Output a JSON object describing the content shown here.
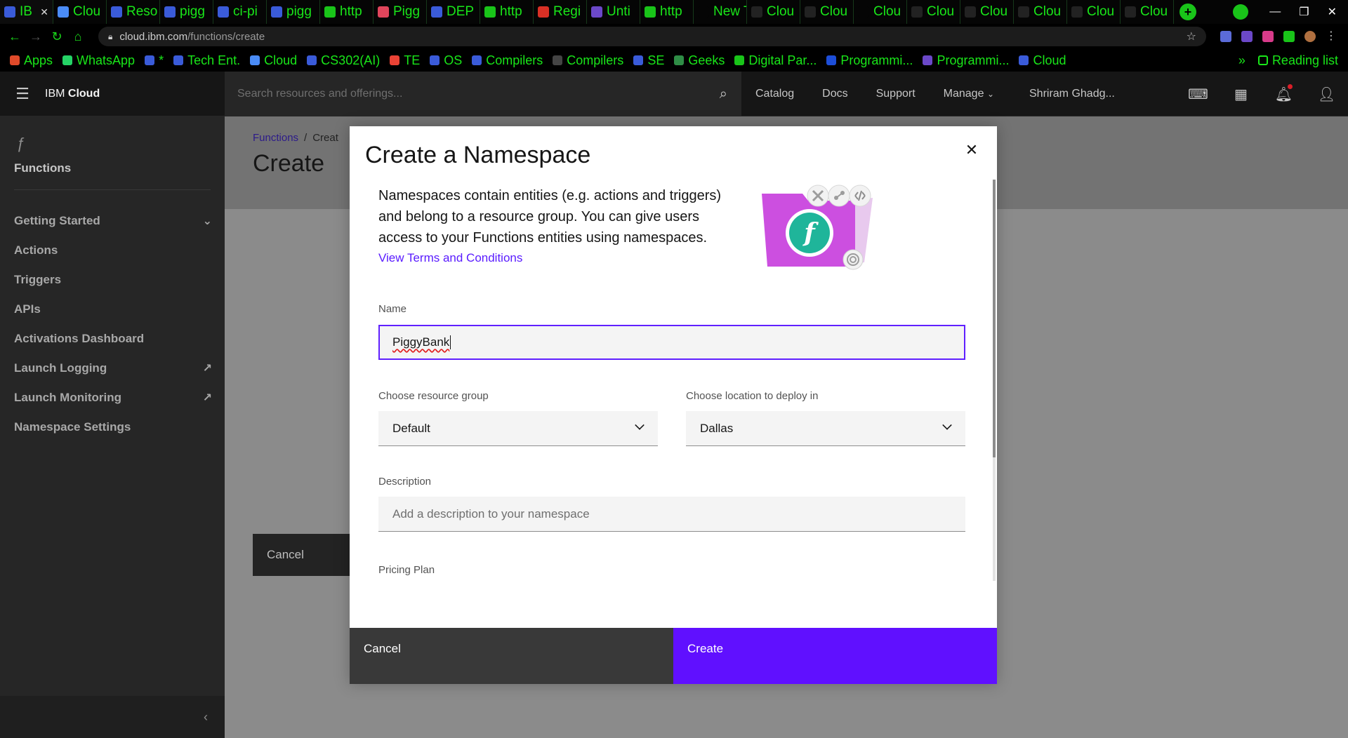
{
  "browser": {
    "tabs": [
      {
        "label": "IB",
        "color": "#3a5bd9",
        "active": true
      },
      {
        "label": "Clou",
        "color": "#4a8cf7"
      },
      {
        "label": "Reso",
        "color": "#3a5bd9"
      },
      {
        "label": "pigg",
        "color": "#3a5bd9"
      },
      {
        "label": "ci-pi",
        "color": "#3a5bd9"
      },
      {
        "label": "pigg",
        "color": "#3a5bd9"
      },
      {
        "label": "http",
        "color": "#19c419"
      },
      {
        "label": "Pigg",
        "color": "#e0455b"
      },
      {
        "label": "DEP",
        "color": "#3a5bd9"
      },
      {
        "label": "http",
        "color": "#19c419"
      },
      {
        "label": "Regi",
        "color": "#d93025"
      },
      {
        "label": "Unti",
        "color": "#6b48c8"
      },
      {
        "label": "http",
        "color": "#19c419"
      },
      {
        "label": "New Ta",
        "color": "#050505"
      },
      {
        "label": "Clou",
        "color": "#222222"
      },
      {
        "label": "Clou",
        "color": "#222222"
      },
      {
        "label": "Clou",
        "color": "#050505"
      },
      {
        "label": "Clou",
        "color": "#222222"
      },
      {
        "label": "Clou",
        "color": "#222222"
      },
      {
        "label": "Clou",
        "color": "#222222"
      },
      {
        "label": "Clou",
        "color": "#222222"
      },
      {
        "label": "Clou",
        "color": "#222222"
      }
    ],
    "new_tab_label": "+",
    "url_host": "cloud.ibm.com",
    "url_path": "/functions/create",
    "bookmarks": [
      {
        "label": "Apps",
        "color": "#e04a2a"
      },
      {
        "label": "WhatsApp",
        "color": "#25d366"
      },
      {
        "label": "*",
        "color": "#3a5bd9"
      },
      {
        "label": "Tech Ent.",
        "color": "#3a5bd9"
      },
      {
        "label": "Cloud",
        "color": "#4a8cf7"
      },
      {
        "label": "CS302(AI)",
        "color": "#3a5bd9"
      },
      {
        "label": "TE",
        "color": "#ea4335"
      },
      {
        "label": "OS",
        "color": "#3a5bd9"
      },
      {
        "label": "Compilers",
        "color": "#3a5bd9"
      },
      {
        "label": "Compilers",
        "color": "#444444"
      },
      {
        "label": "SE",
        "color": "#3a5bd9"
      },
      {
        "label": "Geeks",
        "color": "#2f8d46"
      },
      {
        "label": "Digital Par...",
        "color": "#19c419"
      },
      {
        "label": "Programmi...",
        "color": "#1d4ed8"
      },
      {
        "label": "Programmi...",
        "color": "#6b48c8"
      },
      {
        "label": "Cloud",
        "color": "#3a5bd9"
      }
    ],
    "bookmarks_more": "»",
    "reading_list": "Reading list"
  },
  "header": {
    "menu_icon": "hamburger-icon",
    "brand_prefix": "IBM",
    "brand_suffix": "Cloud",
    "search_placeholder": "Search resources and offerings...",
    "nav": [
      "Catalog",
      "Docs",
      "Support",
      "Manage"
    ],
    "user": "Shriram Ghadg..."
  },
  "sidebar": {
    "title": "Functions",
    "items": [
      {
        "label": "Getting Started",
        "trail": "chevron"
      },
      {
        "label": "Actions"
      },
      {
        "label": "Triggers"
      },
      {
        "label": "APIs"
      },
      {
        "label": "Activations Dashboard"
      },
      {
        "label": "Launch Logging",
        "trail": "external"
      },
      {
        "label": "Launch Monitoring",
        "trail": "external"
      },
      {
        "label": "Namespace Settings"
      }
    ]
  },
  "page": {
    "breadcrumb_link": "Functions",
    "breadcrumb_sep": "/",
    "breadcrumb_current": "Creat",
    "title": "Create",
    "cancel_label": "Cancel"
  },
  "modal": {
    "title": "Create a Namespace",
    "description": "Namespaces contain entities (e.g. actions and triggers) and belong to a resource group. You can give users access to your Functions entities using namespaces.",
    "terms_link": "View Terms and Conditions",
    "name_label": "Name",
    "name_value": "PiggyBank",
    "resource_group_label": "Choose resource group",
    "resource_group_value": "Default",
    "location_label": "Choose location to deploy in",
    "location_value": "Dallas",
    "description_label": "Description",
    "description_placeholder": "Add a description to your namespace",
    "pricing_label": "Pricing Plan",
    "cancel_label": "Cancel",
    "create_label": "Create",
    "illustration_glyph": "f",
    "accent": "#6010ff"
  }
}
